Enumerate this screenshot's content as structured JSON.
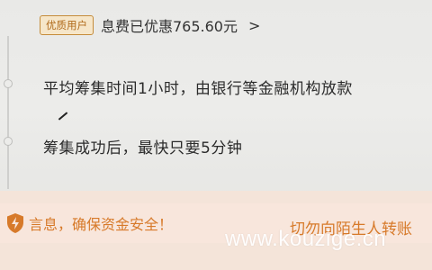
{
  "header": {
    "badge": "优质用户",
    "saving_text": "息费已优惠765.60元",
    "chevron": ">"
  },
  "steps": [
    {
      "text": "平均筹集时间1小时，由银行等金融机构放款"
    },
    {
      "text": "筹集成功后，最快只要5分钟"
    }
  ],
  "warning": {
    "left_text": "言息，确保资金安全！",
    "right_text": "切勿向陌生人转账"
  },
  "watermark": "www.kouzige.cn",
  "colors": {
    "accent": "#d77a2a",
    "badge_border": "#c58c3a",
    "badge_bg": "#f6e6c9",
    "warning_bg": "#f8e6dc"
  }
}
